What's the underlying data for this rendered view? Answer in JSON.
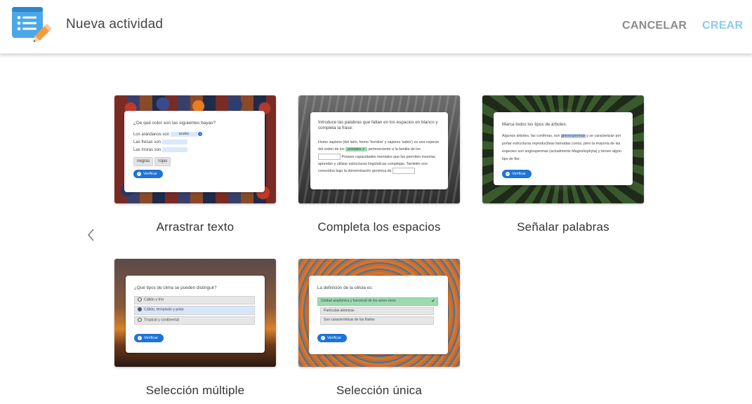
{
  "header": {
    "title": "Nueva actividad",
    "cancel_label": "CANCELAR",
    "create_label": "CREAR"
  },
  "colors": {
    "create": "#8ecbea",
    "cancel": "#8a8a8a",
    "verify_button": "#1e73d6",
    "selected_option": "#d8e6fb",
    "correct_option": "#9ddab0"
  },
  "activities": [
    {
      "label": "Arrastrar texto",
      "preview": {
        "question": "¿De qué color son las siguientes bayas?",
        "lines": [
          "Los arándanos son",
          "Las fresas son",
          "Las moras son"
        ],
        "filled": "azules",
        "badge": "1",
        "chips": [
          "negras",
          "rojas"
        ],
        "verify": "Verificar"
      }
    },
    {
      "label": "Completa los espacios",
      "preview": {
        "question": "Introduce las palabras que faltan en los espacios en blanco y completa la frase:",
        "text1": "Homo sapiens (del latín, homo 'hombre' y sapiens 'sabio') es una especie del orden de los",
        "filled": "primates",
        "text2": "perteneciente a la familia de los",
        "text3": "Poseen capacidades mentales que les permiten inventar, aprender y utilizar estructuras lingüísticas complejas. También son conocidos bajo la denominación genérica de"
      }
    },
    {
      "label": "Señalar palabras",
      "preview": {
        "question": "Marca todos los tipos de árboles:",
        "text1": "Algunos árboles, las coníferas, son",
        "highlight": "gimnospermas",
        "text2": "y se caracterizan por portar estructuras reproductivas llamadas conos, pero la mayoría de las especies son angiospermas (actualmente Magnoliophyta) y tienen algún tipo de flor.",
        "verify": "Verificar"
      }
    },
    {
      "label": "Selección múltiple",
      "preview": {
        "question": "¿Qué tipos de clima se pueden distinguir?",
        "options": [
          "Cálido y frío",
          "Cálido, templado y polar",
          "Tropical y continental"
        ],
        "verify": "Verificar"
      }
    },
    {
      "label": "Selección única",
      "preview": {
        "question": "La definición de la célula es:",
        "options": [
          "Unidad anatómica y funcional de los seres vivos",
          "Partículas atómicas",
          "Son características de los fósiles"
        ],
        "verify": "Verificar"
      }
    }
  ]
}
